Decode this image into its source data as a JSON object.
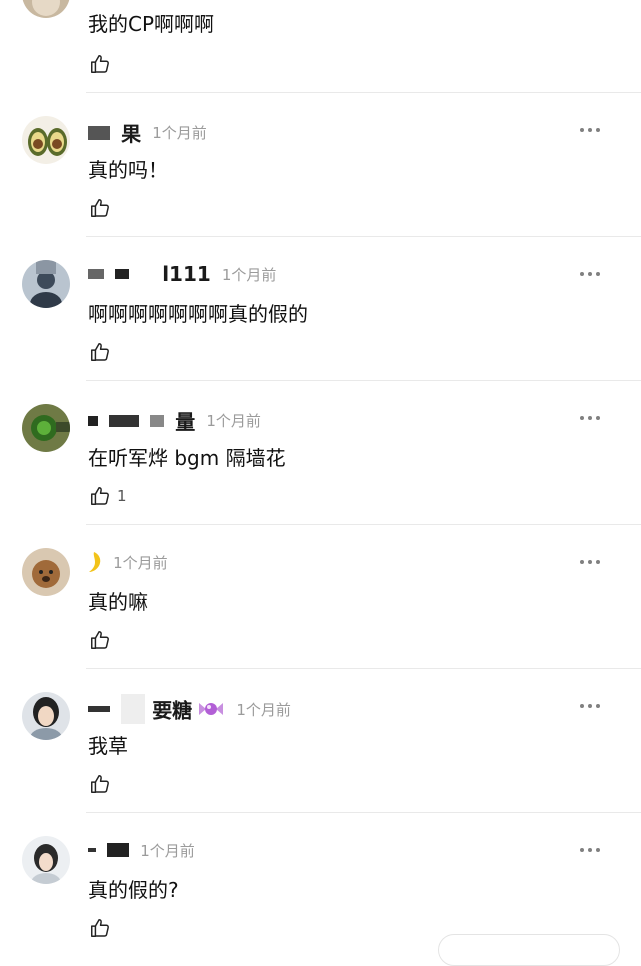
{
  "comments": [
    {
      "name": "",
      "time": "",
      "text": "我的CP啊啊啊",
      "likes": "",
      "avatar_icon": "avatar-person-icon"
    },
    {
      "name": "果",
      "time": "1个月前",
      "text": "真的吗！",
      "likes": "",
      "avatar_icon": "avocado-avatar-icon"
    },
    {
      "name": "l111",
      "time": "1个月前",
      "text": "啊啊啊啊啊啊啊真的假的",
      "likes": "",
      "avatar_icon": "avatar-person-icon"
    },
    {
      "name": "量",
      "time": "1个月前",
      "text": "在听军烨 bgm 隔墙花",
      "likes": "1",
      "avatar_icon": "plant-avatar-icon"
    },
    {
      "name": "",
      "time": "1个月前",
      "text": "真的嘛",
      "likes": "",
      "avatar_icon": "dog-avatar-icon"
    },
    {
      "name": "要糖",
      "time": "1个月前",
      "text": "我草",
      "likes": "",
      "avatar_icon": "girl-avatar-icon"
    },
    {
      "name": "",
      "time": "1个月前",
      "text": "真的假的?",
      "likes": "",
      "avatar_icon": "girl-avatar-icon"
    }
  ],
  "icons": {
    "like": "thumbs-up-icon",
    "more": "more-dots-icon"
  },
  "colors": {
    "time_gray": "#9b9b9b",
    "divider": "#e9e9e9",
    "text": "#111111"
  }
}
